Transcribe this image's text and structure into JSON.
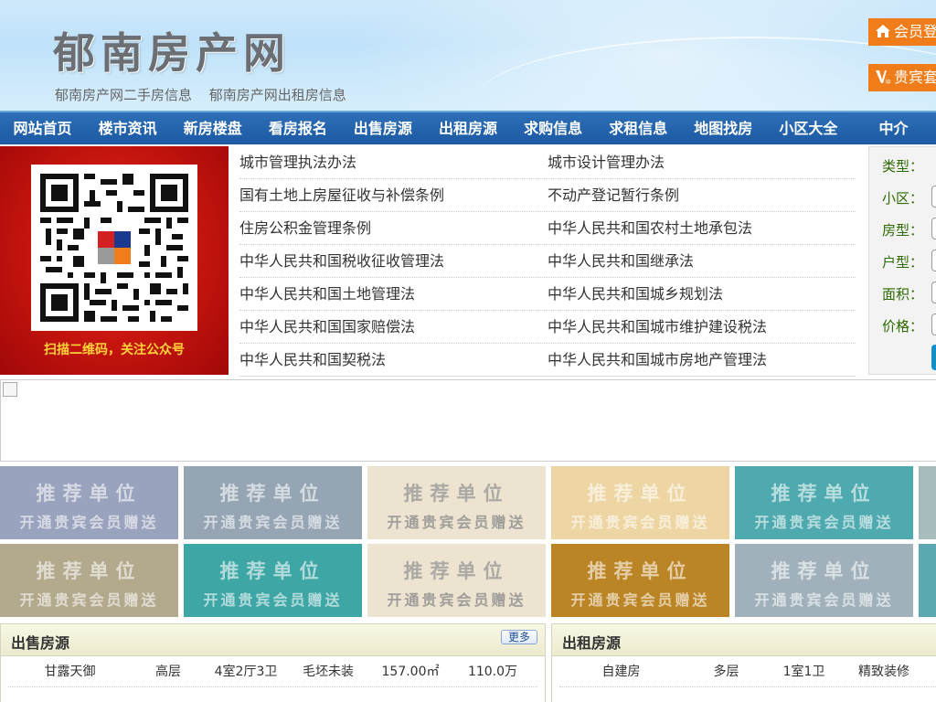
{
  "site": {
    "title": "郁南房产网",
    "sub_links": [
      "郁南房产网二手房信息",
      "郁南房产网出租房信息"
    ],
    "login_label": "会员登录",
    "vip_label": "贵宾套餐"
  },
  "nav": {
    "items": [
      "网站首页",
      "楼市资讯",
      "新房楼盘",
      "看房报名",
      "出售房源",
      "出租房源",
      "求购信息",
      "求租信息",
      "地图找房",
      "小区大全",
      "中介"
    ]
  },
  "promo": {
    "caption": "扫描二维码，关注公众号"
  },
  "laws": {
    "rows": [
      [
        "城市管理执法办法",
        "城市设计管理办法"
      ],
      [
        "国有土地上房屋征收与补偿条例",
        "不动产登记暂行条例"
      ],
      [
        "住房公积金管理条例",
        "中华人民共和国农村土地承包法"
      ],
      [
        "中华人民共和国税收征收管理法",
        "中华人民共和国继承法"
      ],
      [
        "中华人民共和国土地管理法",
        "中华人民共和国城乡规划法"
      ],
      [
        "中华人民共和国国家赔偿法",
        "中华人民共和国城市维护建设税法"
      ],
      [
        "中华人民共和国契税法",
        "中华人民共和国城市房地产管理法"
      ]
    ]
  },
  "search": {
    "labels": [
      "类型：",
      "小区：",
      "房型：",
      "户型：",
      "面积：",
      "价格："
    ]
  },
  "tiles": {
    "line1": "推荐单位",
    "line2": "开通贵宾会员赠送",
    "colors_row1": [
      "#9aa3bd",
      "#95a5b3",
      "#ece3d0",
      "#eed6a4",
      "#4eaaaf",
      "#a7bcbc"
    ],
    "colors_row2": [
      "#b3a98c",
      "#3ea6a5",
      "#ece3d0",
      "#bb8424",
      "#a0b1bb",
      "#5aa9b0"
    ]
  },
  "sale": {
    "title": "出售房源",
    "more": "更多",
    "rows": [
      [
        "甘露天御",
        "高层",
        "4室2厅3卫",
        "毛坯未装",
        "157.00㎡",
        "110.0万"
      ]
    ]
  },
  "rent": {
    "title": "出租房源",
    "rows": [
      [
        "自建房",
        "多层",
        "1室1卫",
        "精致装修"
      ]
    ]
  }
}
